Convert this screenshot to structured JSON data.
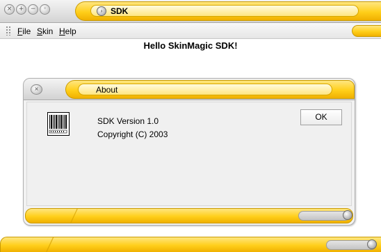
{
  "window": {
    "title": "SDK",
    "controls": [
      {
        "icon": "close-icon",
        "glyph": "×"
      },
      {
        "icon": "maximize-icon",
        "glyph": "+"
      },
      {
        "icon": "minimize-icon",
        "glyph": "−"
      },
      {
        "icon": "options-icon",
        "glyph": "◦"
      }
    ],
    "system_icon": {
      "icon": "system-menu-icon",
      "glyph": "›"
    }
  },
  "menu": {
    "items": [
      {
        "label": "File",
        "mnemonic": "F",
        "rest": "ile"
      },
      {
        "label": "Skin",
        "mnemonic": "S",
        "rest": "kin"
      },
      {
        "label": "Help",
        "mnemonic": "H",
        "rest": "elp"
      }
    ]
  },
  "content": {
    "heading": "Hello SkinMagic SDK!"
  },
  "about_dialog": {
    "title": "About",
    "close_glyph": "×",
    "version": "SDK Version 1.0",
    "copyright": "Copyright (C) 2003",
    "ok_label": "OK",
    "logo_icon": "barcode-icon"
  },
  "theme": {
    "accent": "#ffcf1a",
    "accent_dark": "#c99a00",
    "chrome": "#d4d4d4",
    "background": "#ffffff"
  }
}
